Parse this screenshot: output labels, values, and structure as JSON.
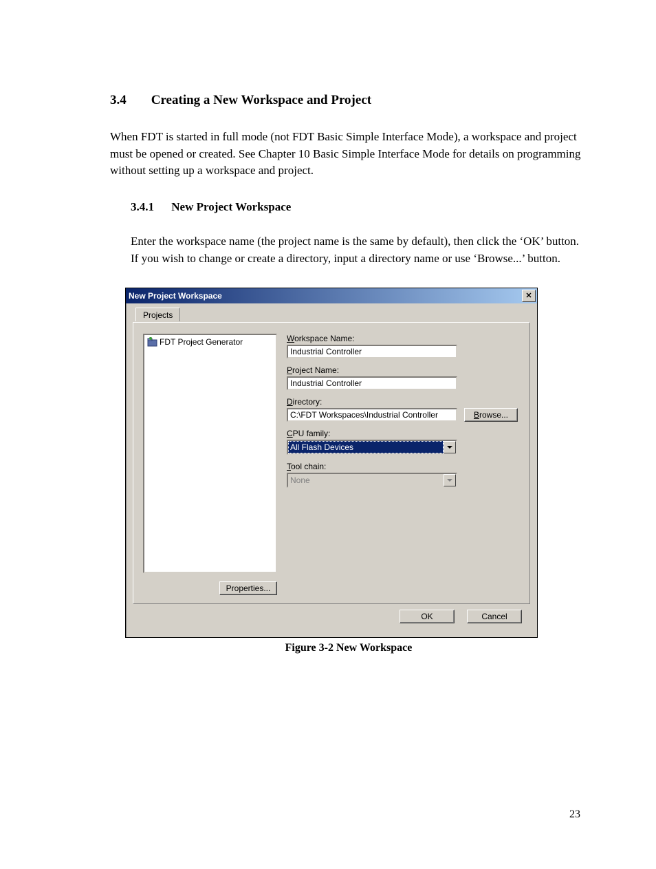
{
  "doc": {
    "section_number": "3.4",
    "section_title": "Creating a New Workspace and Project",
    "intro_paragraph": "When FDT is started in full mode (not FDT Basic Simple Interface Mode), a workspace and project must be opened or created. See Chapter 10  Basic Simple Interface Mode for details on programming without setting up a workspace and project.",
    "subsection_number": "3.4.1",
    "subsection_title": "New Project Workspace",
    "subsection_paragraph": "Enter the workspace name (the project name is the same by default), then click the ‘OK’ button. If you wish to change or create a directory, input a directory name or use ‘Browse...’ button.",
    "figure_caption": "Figure 3-2 New Workspace",
    "page_number": "23"
  },
  "dialog": {
    "title": "New Project Workspace",
    "close_glyph": "✕",
    "tab_label": "Projects",
    "list_item": "FDT Project Generator",
    "labels": {
      "workspace_name_u": "W",
      "workspace_name_rest": "orkspace Name:",
      "project_name_u": "P",
      "project_name_rest": "roject Name:",
      "directory_u": "D",
      "directory_rest": "irectory:",
      "cpu_family_u": "C",
      "cpu_family_rest": "PU family:",
      "tool_chain_u": "T",
      "tool_chain_rest": "ool chain:",
      "browse_u": "B",
      "browse_rest": "rowse..."
    },
    "values": {
      "workspace_name": "Industrial Controller",
      "project_name": "Industrial Controller",
      "directory": "C:\\FDT Workspaces\\Industrial Controller",
      "cpu_family": "All Flash Devices",
      "tool_chain": "None"
    },
    "buttons": {
      "properties": "Properties...",
      "ok": "OK",
      "cancel": "Cancel"
    }
  }
}
